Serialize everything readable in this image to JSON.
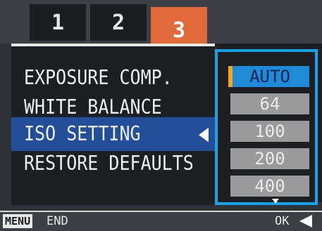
{
  "tabs": [
    {
      "label": "1",
      "active": false
    },
    {
      "label": "2",
      "active": false
    },
    {
      "label": "3",
      "active": true
    }
  ],
  "menu": {
    "items": [
      {
        "label": "EXPOSURE COMP.",
        "selected": false
      },
      {
        "label": "WHITE BALANCE",
        "selected": false
      },
      {
        "label": "ISO SETTING",
        "selected": true
      },
      {
        "label": "RESTORE DEFAULTS",
        "selected": false
      }
    ]
  },
  "options": {
    "items": [
      {
        "label": "AUTO",
        "active": true
      },
      {
        "label": "64",
        "active": false
      },
      {
        "label": "100",
        "active": false
      },
      {
        "label": "200",
        "active": false
      },
      {
        "label": "400",
        "active": false
      }
    ]
  },
  "footer": {
    "menu_key": "MENU",
    "end_label": "END",
    "ok_label": "OK"
  },
  "colors": {
    "active_tab": "#e06a3a",
    "selection": "#234e9a",
    "option_highlight": "#1f8ad8",
    "option_frame": "#19a3e8",
    "marker": "#f2a61e"
  },
  "icons": {
    "selection_arrow": "left-arrow-icon",
    "ok_arrow": "left-arrow-icon",
    "scroll_indicator": "down-arrow-icon"
  }
}
